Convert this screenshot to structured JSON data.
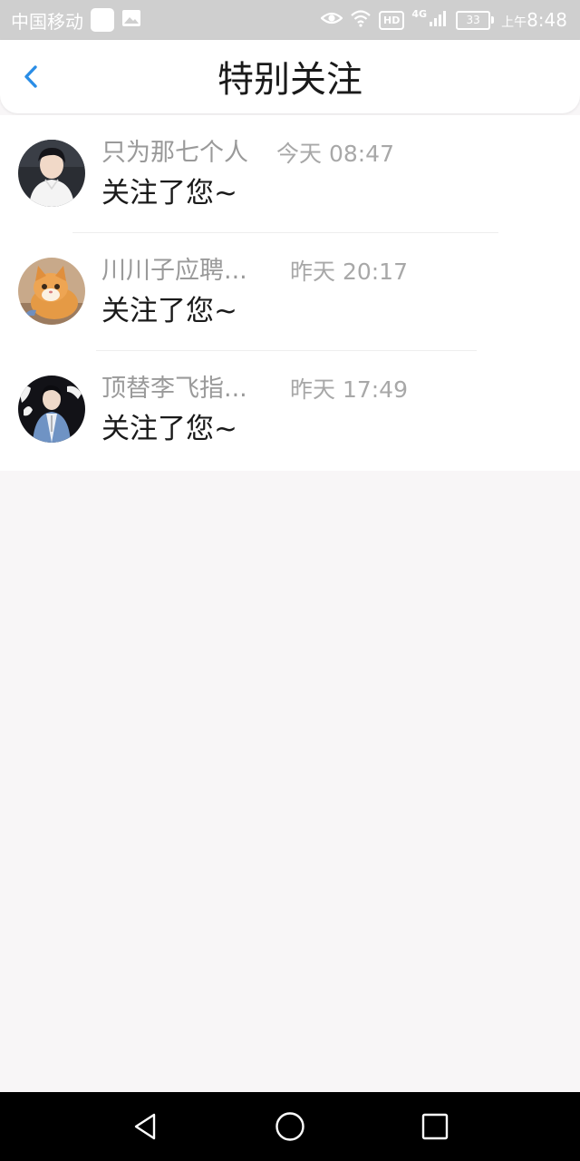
{
  "status_bar": {
    "carrier": "中国移动",
    "hd_label": "HD",
    "network_label": "4G",
    "battery_level": "33",
    "clock_ampm": "上午",
    "clock_time": "8:48",
    "icons": [
      "notification-square-icon",
      "gallery-icon",
      "eye-icon",
      "wifi-icon",
      "signal-icon",
      "battery-icon"
    ]
  },
  "header": {
    "title": "特别关注",
    "back_icon": "chevron-left-icon",
    "accent_color": "#2a8de6"
  },
  "follows": [
    {
      "name": "只为那七个人",
      "time": "今天 08:47",
      "message": "关注了您~",
      "avatar": "avatar-person-white-shirt"
    },
    {
      "name": "川川子应聘...",
      "time": "昨天 20:17",
      "message": "关注了您~",
      "avatar": "avatar-orange-kitten"
    },
    {
      "name": "顶替李飞指...",
      "time": "昨天 17:49",
      "message": "关注了您~",
      "avatar": "avatar-person-blue-outfit"
    }
  ],
  "system_nav": {
    "icons": [
      "back-triangle-icon",
      "home-circle-icon",
      "recents-square-icon"
    ]
  }
}
